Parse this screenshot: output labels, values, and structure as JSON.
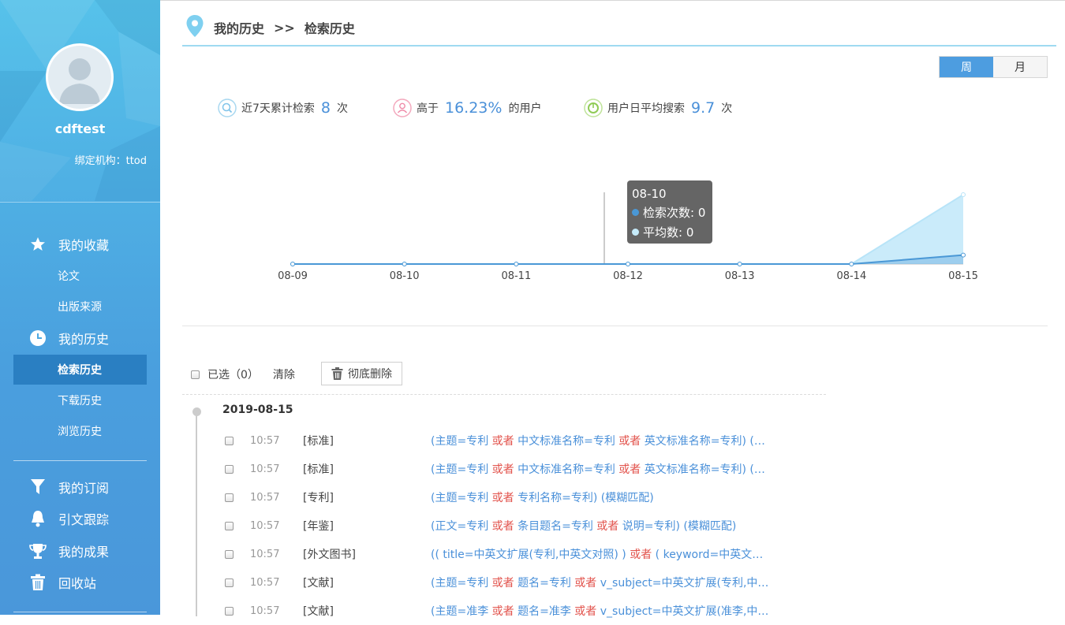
{
  "sidebar": {
    "username": "cdftest",
    "org": "绑定机构：ttod",
    "nav": [
      {
        "label": "我的收藏",
        "icon": "star-icon"
      },
      {
        "label": "我的历史",
        "icon": "clock-icon"
      },
      {
        "label": "我的订阅",
        "icon": "funnel-icon"
      },
      {
        "label": "引文跟踪",
        "icon": "bell-icon"
      },
      {
        "label": "我的成果",
        "icon": "trophy-icon"
      },
      {
        "label": "回收站",
        "icon": "trash-icon"
      }
    ],
    "sub": [
      "论文",
      "出版来源",
      "检索历史",
      "下载历史",
      "浏览历史"
    ]
  },
  "breadcrumb": {
    "parent": "我的历史",
    "sep": ">>",
    "current": "检索历史"
  },
  "toggle": {
    "week": "周",
    "month": "月"
  },
  "stats": {
    "s1_label": "近7天累计检索",
    "s1_value": "8",
    "s1_unit": "次",
    "s2_label": "高于",
    "s2_value": "16.23%",
    "s2_unit": "的用户",
    "s3_label": "用户日平均搜索",
    "s3_value": "9.7",
    "s3_unit": "次"
  },
  "chart_data": {
    "type": "area",
    "categories": [
      "08-09",
      "08-10",
      "08-11",
      "08-12",
      "08-13",
      "08-14",
      "08-15"
    ],
    "series": [
      {
        "name": "检索次数",
        "values": [
          0,
          0,
          0,
          0,
          0,
          0,
          8
        ],
        "color": "#4a98d6"
      },
      {
        "name": "平均数",
        "values": [
          0,
          0,
          0,
          0,
          0,
          0,
          62.1
        ],
        "color": "#b8e4f8"
      }
    ],
    "ylim": [
      0,
      62.1
    ],
    "tooltip": {
      "title": "08-10",
      "rows": [
        "检索次数: 0",
        "平均数: 0"
      ]
    }
  },
  "toolbar": {
    "selected": "已选（0）",
    "clear": "清除",
    "delete": "彻底删除"
  },
  "history": {
    "date": "2019-08-15",
    "rows": [
      {
        "time": "10:57",
        "type": "[标准]",
        "parts": [
          [
            "(主题=专利 ",
            0
          ],
          [
            "或者",
            1
          ],
          [
            " 中文标准名称=专利 ",
            0
          ],
          [
            "或者",
            1
          ],
          [
            " 英文标准名称=专利) (模糊匹配)",
            0
          ]
        ]
      },
      {
        "time": "10:57",
        "type": "[标准]",
        "parts": [
          [
            "(主题=专利 ",
            0
          ],
          [
            "或者",
            1
          ],
          [
            " 中文标准名称=专利 ",
            0
          ],
          [
            "或者",
            1
          ],
          [
            " 英文标准名称=专利) (模糊匹配)",
            0
          ]
        ]
      },
      {
        "time": "10:57",
        "type": "[专利]",
        "parts": [
          [
            "(主题=专利 ",
            0
          ],
          [
            "或者",
            1
          ],
          [
            " 专利名称=专利) (模糊匹配)",
            0
          ]
        ]
      },
      {
        "time": "10:57",
        "type": "[年鉴]",
        "parts": [
          [
            "(正文=专利 ",
            0
          ],
          [
            "或者",
            1
          ],
          [
            " 条目题名=专利 ",
            0
          ],
          [
            "或者",
            1
          ],
          [
            " 说明=专利) (模糊匹配)",
            0
          ]
        ]
      },
      {
        "time": "10:57",
        "type": "[外文图书]",
        "parts": [
          [
            "(( title=中英文扩展(专利,中英文对照) ) ",
            0
          ],
          [
            "或者",
            1
          ],
          [
            " ( keyword=中英文扩展(专利,中英文对照) )",
            0
          ]
        ]
      },
      {
        "time": "10:57",
        "type": "[文献]",
        "parts": [
          [
            "(主题=专利 ",
            0
          ],
          [
            "或者",
            1
          ],
          [
            " 题名=专利 ",
            0
          ],
          [
            "或者",
            1
          ],
          [
            " v_subject=中英文扩展(专利,中英文对照)",
            0
          ]
        ]
      },
      {
        "time": "10:57",
        "type": "[文献]",
        "parts": [
          [
            "(主题=准李 ",
            0
          ],
          [
            "或者",
            1
          ],
          [
            " 题名=准李 ",
            0
          ],
          [
            "或者",
            1
          ],
          [
            " v_subject=中英文扩展(准李,中英文对照)",
            0
          ]
        ]
      }
    ]
  }
}
